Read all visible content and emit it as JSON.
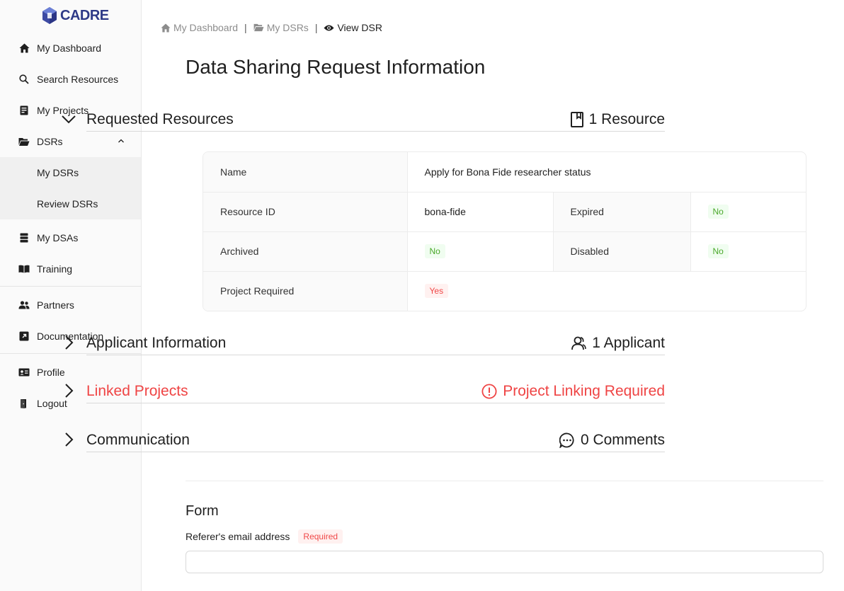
{
  "app": {
    "logo_text": "CADRE",
    "brand_color": "#2e3a87"
  },
  "sidebar": {
    "items": [
      {
        "label": "My Dashboard",
        "icon": "home-icon"
      },
      {
        "label": "Search Resources",
        "icon": "search-icon"
      },
      {
        "label": "My Projects",
        "icon": "projects-icon"
      },
      {
        "label": "DSRs",
        "icon": "folder-open-icon",
        "expanded": true,
        "children": [
          {
            "label": "My DSRs"
          },
          {
            "label": "Review DSRs"
          }
        ]
      },
      {
        "label": "My DSAs",
        "icon": "database-icon"
      },
      {
        "label": "Training",
        "icon": "book-icon"
      },
      {
        "label": "Partners",
        "icon": "team-icon"
      },
      {
        "label": "Documentation",
        "icon": "external-link-icon"
      },
      {
        "label": "Profile",
        "icon": "id-card-icon"
      },
      {
        "label": "Logout",
        "icon": "logout-icon"
      }
    ]
  },
  "breadcrumb": [
    {
      "label": "My Dashboard",
      "icon": "home-icon"
    },
    {
      "label": "My DSRs",
      "icon": "folder-open-icon"
    },
    {
      "label": "View DSR",
      "icon": "eye-icon"
    }
  ],
  "page": {
    "title": "Data Sharing Request Information"
  },
  "sections": {
    "requested_resources": {
      "title": "Requested Resources",
      "meta": "1 Resource",
      "expanded": true
    },
    "applicant_information": {
      "title": "Applicant Information",
      "meta": "1 Applicant",
      "expanded": false
    },
    "linked_projects": {
      "title": "Linked Projects",
      "meta": "Project Linking Required",
      "expanded": false,
      "status_color": "#ef4444"
    },
    "communication": {
      "title": "Communication",
      "meta": "0 Comments",
      "expanded": false
    }
  },
  "resource": {
    "name_label": "Name",
    "name_value": "Apply for Bona Fide researcher status",
    "id_label": "Resource ID",
    "id_value": "bona-fide",
    "expired_label": "Expired",
    "expired_value": "No",
    "archived_label": "Archived",
    "archived_value": "No",
    "disabled_label": "Disabled",
    "disabled_value": "No",
    "project_required_label": "Project Required",
    "project_required_value": "Yes"
  },
  "form": {
    "title": "Form",
    "email_label": "Referer's email address",
    "required_tag": "Required",
    "email_value": ""
  }
}
